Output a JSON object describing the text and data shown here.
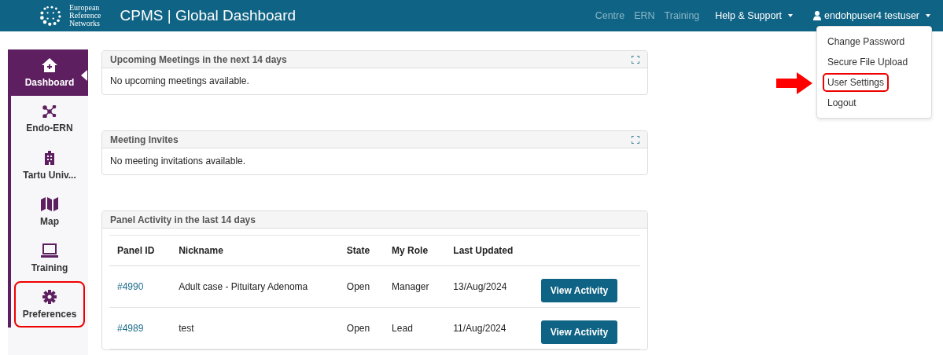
{
  "navbar": {
    "logo_lines": [
      "European",
      "Reference",
      "Networks"
    ],
    "title": "CPMS | Global Dashboard",
    "links": [
      {
        "label": "Centre",
        "kind": "link"
      },
      {
        "label": "ERN",
        "kind": "link"
      },
      {
        "label": "Training",
        "kind": "link"
      },
      {
        "label": "Help & Support",
        "kind": "menu"
      }
    ],
    "user": {
      "label": "endohpuser4 testuser",
      "expanded": true
    }
  },
  "user_menu": [
    {
      "label": "Change Password",
      "highlighted": false
    },
    {
      "label": "Secure File Upload",
      "highlighted": false
    },
    {
      "label": "User Settings",
      "highlighted": true
    },
    {
      "label": "Logout",
      "highlighted": false
    }
  ],
  "sidebar": {
    "items": [
      {
        "label": "Dashboard",
        "kind": "home",
        "selected": true,
        "highlighted": false
      },
      {
        "label": "Endo-ERN",
        "kind": "network",
        "selected": false,
        "highlighted": false
      },
      {
        "label": "Tartu Univ...",
        "kind": "building",
        "selected": false,
        "highlighted": false
      },
      {
        "label": "Map",
        "kind": "map",
        "selected": false,
        "highlighted": false
      },
      {
        "label": "Training",
        "kind": "laptop",
        "selected": false,
        "highlighted": false
      },
      {
        "label": "Preferences",
        "kind": "gear",
        "selected": false,
        "highlighted": true
      }
    ]
  },
  "panels": [
    {
      "title": "Upcoming Meetings in the next 14 days",
      "expandable": true,
      "message": "No upcoming meetings available."
    },
    {
      "title": "Meeting Invites",
      "expandable": true,
      "message": "No meeting invitations available."
    },
    {
      "title": "Panel Activity in the last 14 days",
      "expandable": false,
      "table": {
        "columns": [
          "Panel ID",
          "Nickname",
          "State",
          "My Role",
          "Last Updated"
        ],
        "rows": [
          {
            "cells": [
              "#4990",
              "Adult case - Pituitary Adenoma",
              "Open",
              "Manager",
              "13/Aug/2024"
            ],
            "action": "View Activity"
          },
          {
            "cells": [
              "#4989",
              "test",
              "Open",
              "Lead",
              "11/Aug/2024"
            ],
            "action": "View Activity"
          }
        ]
      }
    }
  ]
}
